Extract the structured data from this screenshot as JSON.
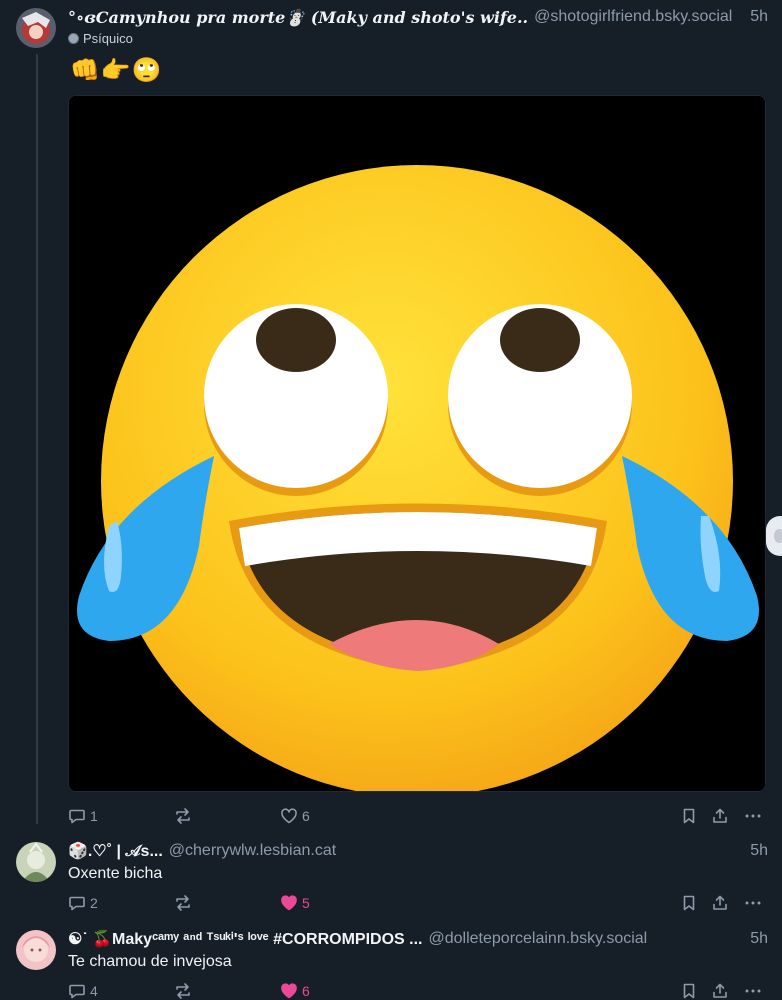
{
  "posts": [
    {
      "display_name": "°∘ɞCamynhou pra morte☃️ (Maky and shoto's wife..",
      "handle": "@shotogirlfriend.bsky.social",
      "time": "5h",
      "label": "Psíquico",
      "emoji_text": "👊👉🙄",
      "media_alt": "loudly crying laughing emoji looking up",
      "replies": "1",
      "reposts": "",
      "likes": "6",
      "liked": false
    },
    {
      "display_name": "🎲.♡˚ | 𝒜s...",
      "handle": "@cherrywlw.lesbian.cat",
      "time": "5h",
      "text": "Oxente bicha",
      "replies": "2",
      "reposts": "",
      "likes": "5",
      "liked": true
    },
    {
      "display_name": "☯︎˙ 🍒Makyᶜᵃᵐʸ ᵃⁿᵈ ᵀˢᵘᵏⁱ'ˢ ˡᵒᵛᵉ #CORROMPIDOS ...",
      "handle": "@dolleteporcelainn.bsky.social",
      "time": "5h",
      "text": "Te chamou de invejosa",
      "replies": "4",
      "reposts": "",
      "likes": "6",
      "liked": true
    }
  ],
  "icons": {
    "reply": "speech-bubble-icon",
    "repost": "repost-arrows-icon",
    "like": "heart-icon",
    "bookmark": "bookmark-icon",
    "share": "share-icon",
    "more": "ellipsis-icon"
  },
  "colors": {
    "background": "#161e27",
    "muted": "#8d9bab",
    "like_active": "#ec4899"
  }
}
